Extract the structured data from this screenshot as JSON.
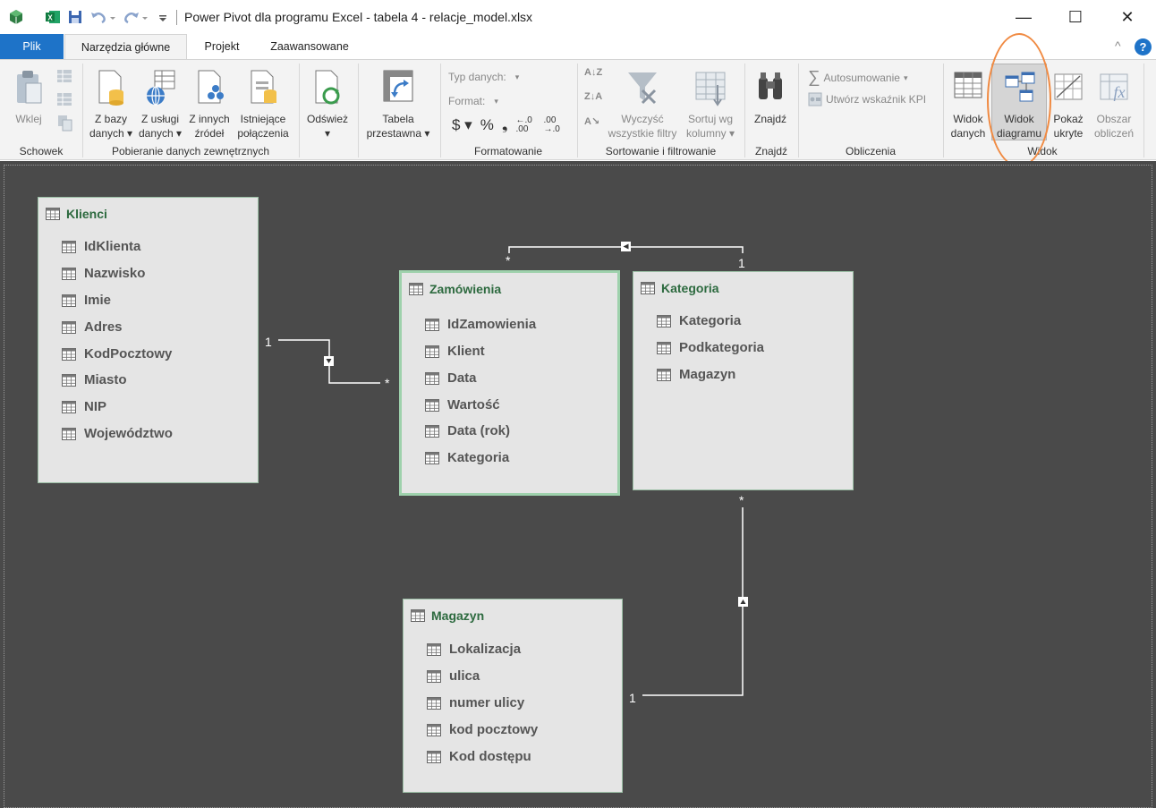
{
  "window": {
    "title": "Power Pivot dla programu Excel - tabela 4 - relacje_model.xlsx",
    "minimize": "—",
    "maximize": "☐",
    "close": "✕"
  },
  "tabs": {
    "file": "Plik",
    "home": "Narzędzia główne",
    "project": "Projekt",
    "advanced": "Zaawansowane",
    "collapse": "^",
    "help": "?"
  },
  "ribbon": {
    "clipboard": {
      "paste": "Wklej",
      "group": "Schowek"
    },
    "external": {
      "from_db_1": "Z bazy",
      "from_db_2": "danych ▾",
      "from_service_1": "Z usługi",
      "from_service_2": "danych ▾",
      "from_other_1": "Z innych",
      "from_other_2": "źródeł",
      "existing_1": "Istniejące",
      "existing_2": "połączenia",
      "group": "Pobieranie danych zewnętrznych"
    },
    "refresh": {
      "label": "Odśwież",
      "arrow": "▾"
    },
    "pivot": {
      "label_1": "Tabela",
      "label_2": "przestawna ▾"
    },
    "formatting": {
      "data_type": "Typ danych:",
      "format": "Format:",
      "currency": "$ ▾",
      "percent": "%",
      "comma": "❟",
      "inc_dec": "←.0 .00",
      "dec_dec": ".00 →.0",
      "dropdown": "▾",
      "group": "Formatowanie"
    },
    "sort": {
      "sort_az": "A↓Z",
      "sort_za": "Z↓A",
      "clear_sort": "A↘",
      "clear_filters_1": "Wyczyść",
      "clear_filters_2": "wszystkie filtry",
      "sort_by_col_1": "Sortuj wg",
      "sort_by_col_2": "kolumny ▾",
      "group": "Sortowanie i filtrowanie"
    },
    "find": {
      "label": "Znajdź",
      "group": "Znajdź"
    },
    "calculations": {
      "autosum": "Autosumowanie",
      "autosum_arrow": "▾",
      "kpi": "Utwórz wskaźnik KPI",
      "sigma": "∑",
      "group": "Obliczenia"
    },
    "view": {
      "data_view_1": "Widok",
      "data_view_2": "danych",
      "diagram_view_1": "Widok",
      "diagram_view_2": "diagramu",
      "show_hidden_1": "Pokaż",
      "show_hidden_2": "ukryte",
      "calc_area_1": "Obszar",
      "calc_area_2": "obliczeń",
      "group": "Widok"
    }
  },
  "diagram": {
    "tables": {
      "klienci": {
        "title": "Klienci",
        "columns": [
          "IdKlienta",
          "Nazwisko",
          "Imie",
          "Adres",
          "KodPocztowy",
          "Miasto",
          "NIP",
          "Województwo"
        ]
      },
      "zamowienia": {
        "title": "Zamówienia",
        "columns": [
          "IdZamowienia",
          "Klient",
          "Data",
          "Wartość",
          "Data (rok)",
          "Kategoria"
        ]
      },
      "kategoria": {
        "title": "Kategoria",
        "columns": [
          "Kategoria",
          "Podkategoria",
          "Magazyn"
        ]
      },
      "magazyn": {
        "title": "Magazyn",
        "columns": [
          "Lokalizacja",
          "ulica",
          "numer ulicy",
          "kod pocztowy",
          "Kod dostępu"
        ]
      }
    },
    "relations": {
      "klienci_zam": {
        "one": "1",
        "many": "*"
      },
      "zam_kat": {
        "one": "1",
        "many": "*"
      },
      "mag_kat": {
        "one": "1",
        "many": "*"
      }
    }
  },
  "colors": {
    "file_tab": "#1e73c8",
    "canvas": "#4a4a4a",
    "table_title": "#2d6a3f",
    "highlight": "#f08a42"
  }
}
